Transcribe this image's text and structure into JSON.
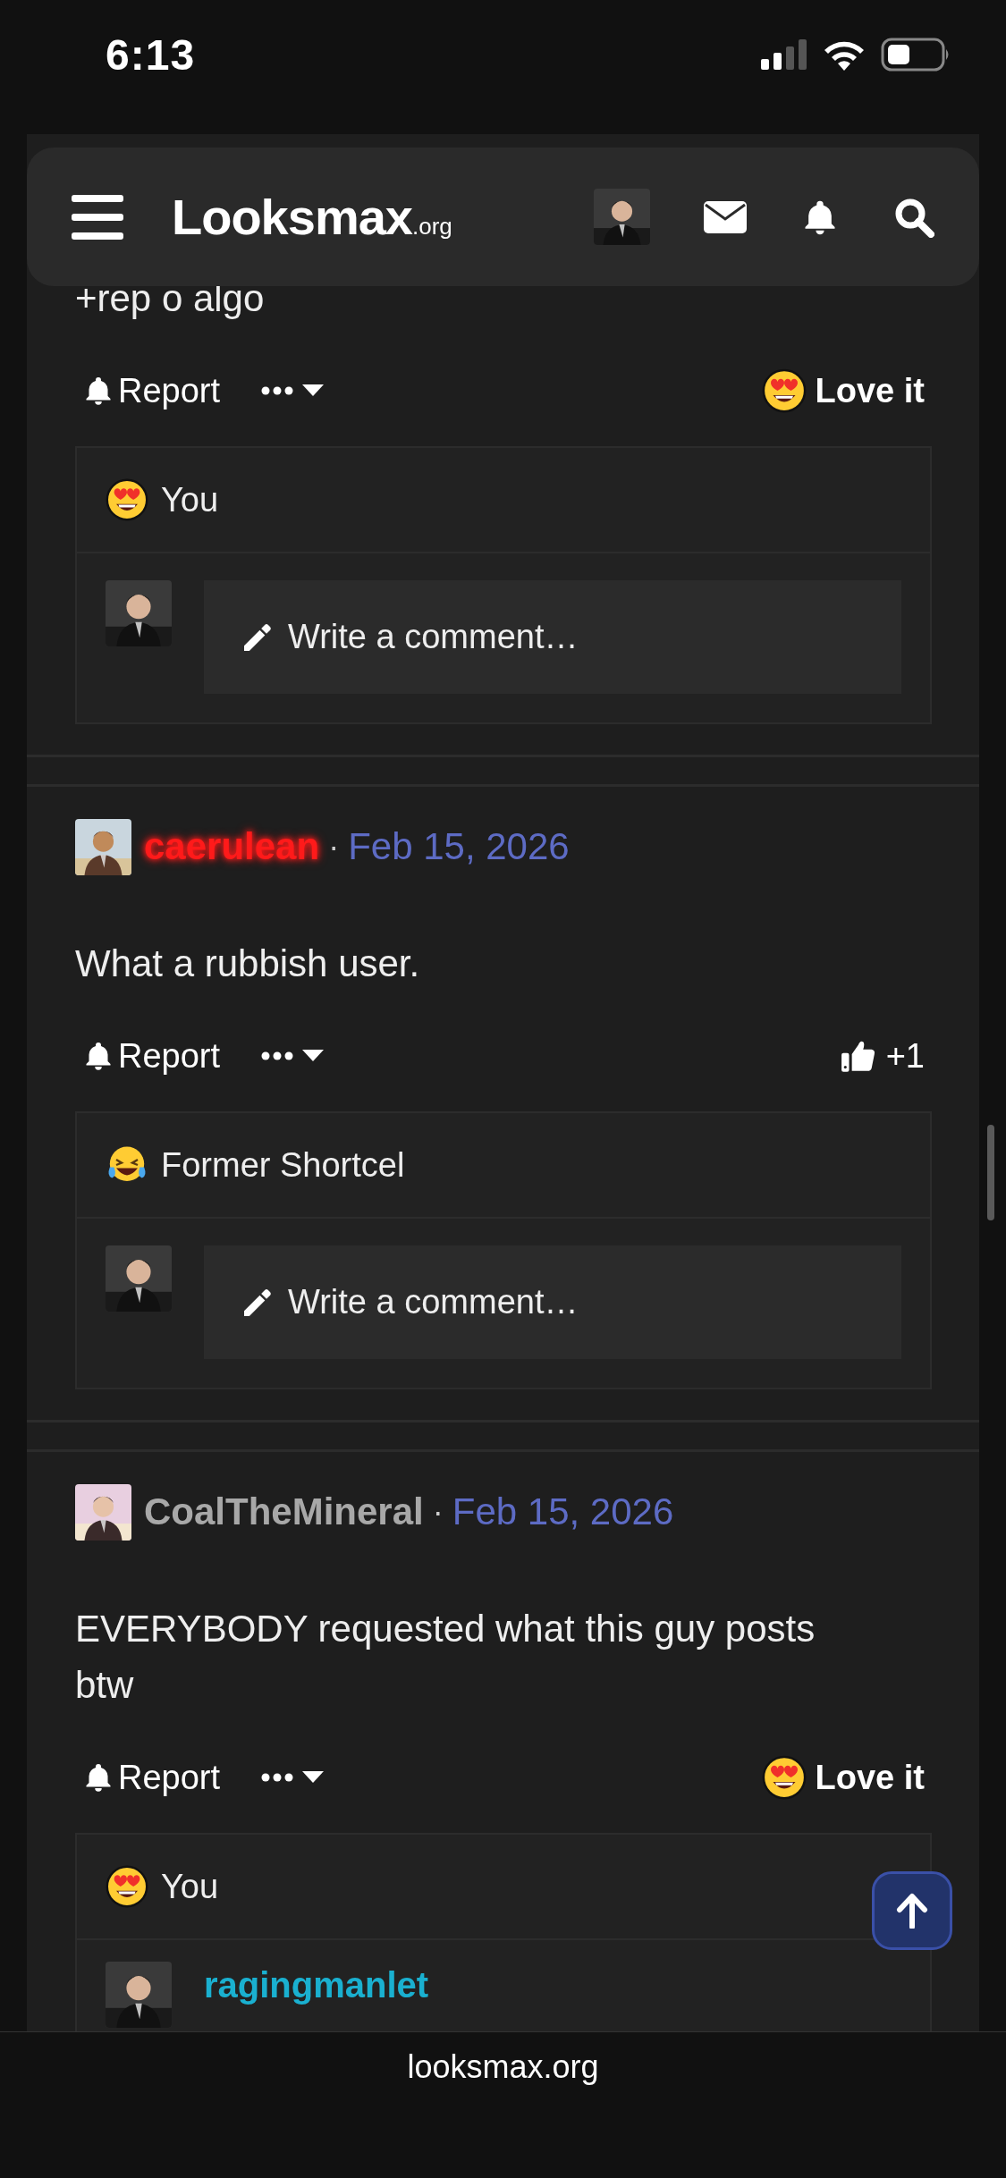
{
  "status_bar": {
    "time": "6:13"
  },
  "header": {
    "logo": "Looksmax",
    "logo_suffix": ".org"
  },
  "posts": [
    {
      "body": "+rep o algo",
      "actions": {
        "report": "Report",
        "reaction": {
          "kind": "love",
          "label": "Love it"
        }
      },
      "reactions_summary": {
        "kind": "love",
        "text": "You"
      },
      "comment": {
        "kind": "composer",
        "placeholder": "Write a comment…"
      }
    },
    {
      "author": {
        "name": "caerulean",
        "color": "#ff1a1a",
        "glow": true
      },
      "separator": "·",
      "date": "Feb 15, 2026",
      "body": "What a rubbish user.",
      "actions": {
        "report": "Report",
        "reaction": {
          "kind": "like",
          "label": "+1"
        }
      },
      "reactions_summary": {
        "kind": "laugh",
        "text": "Former Shortcel"
      },
      "comment": {
        "kind": "composer",
        "placeholder": "Write a comment…"
      }
    },
    {
      "author": {
        "name": "CoalTheMineral",
        "color": "#a8a8a8",
        "glow": false
      },
      "separator": "·",
      "date": "Feb 15, 2026",
      "body": "EVERYBODY requested what this guy posts btw",
      "actions": {
        "report": "Report",
        "reaction": {
          "kind": "love",
          "label": "Love it"
        }
      },
      "reactions_summary": {
        "kind": "love",
        "text": "You"
      },
      "comment": {
        "kind": "comment",
        "author": "ragingmanlet"
      }
    }
  ],
  "footer": {
    "domain": "looksmax.org"
  }
}
